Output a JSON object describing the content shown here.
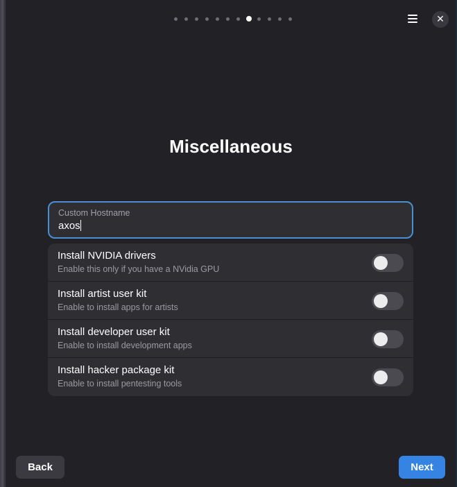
{
  "header": {
    "page_count": 12,
    "active_page": 8,
    "menu_icon": "hamburger-menu-icon",
    "close_icon": "close-icon",
    "close_glyph": "✕"
  },
  "main": {
    "title": "Miscellaneous",
    "hostname": {
      "label": "Custom Hostname",
      "value": "axos"
    },
    "options": [
      {
        "title": "Install NVIDIA drivers",
        "subtitle": "Enable this only if you have a NVidia GPU",
        "enabled": false
      },
      {
        "title": "Install artist user kit",
        "subtitle": "Enable to install apps for artists",
        "enabled": false
      },
      {
        "title": "Install developer user kit",
        "subtitle": "Enable to install development apps",
        "enabled": false
      },
      {
        "title": "Install hacker package kit",
        "subtitle": "Enable to install pentesting tools",
        "enabled": false
      }
    ]
  },
  "footer": {
    "back_label": "Back",
    "next_label": "Next"
  },
  "colors": {
    "accent": "#3584e4",
    "focus_border": "#4a8fd4",
    "window_bg": "#222226",
    "card_bg": "#2e2e33"
  }
}
